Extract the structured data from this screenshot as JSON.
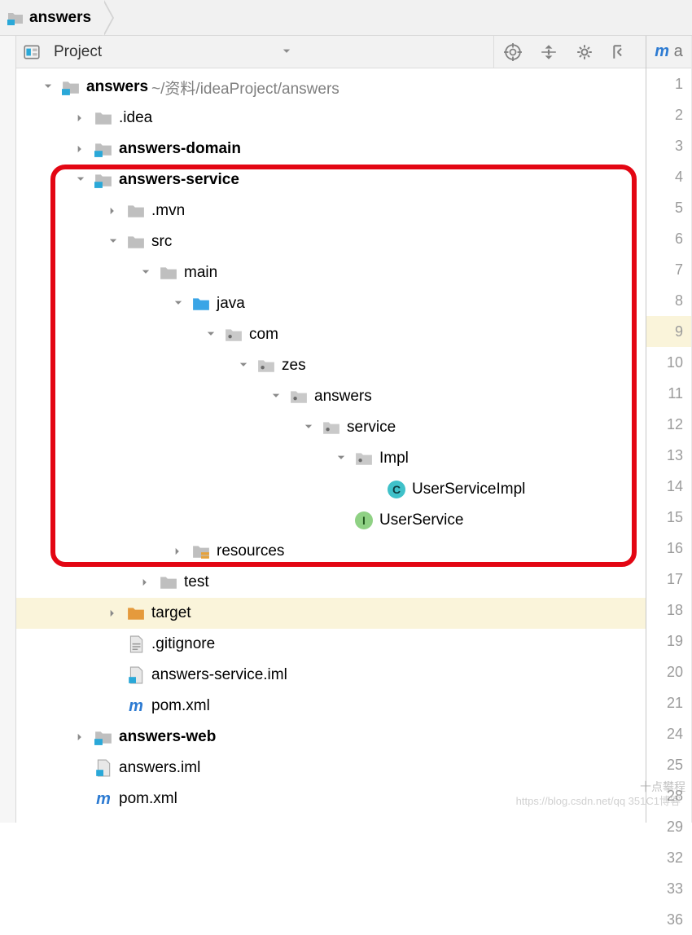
{
  "breadcrumb": {
    "root": "answers"
  },
  "panel": {
    "title": "Project",
    "gutterTopGlyph": "m",
    "gutterTopTrail": "a"
  },
  "tree": {
    "root": {
      "name": "answers",
      "path": "~/资料/ideaProject/answers"
    },
    "rows": [
      {
        "label": ".idea"
      },
      {
        "label": "answers-domain"
      },
      {
        "label": "answers-service"
      },
      {
        "label": ".mvn"
      },
      {
        "label": "src"
      },
      {
        "label": "main"
      },
      {
        "label": "java"
      },
      {
        "label": "com"
      },
      {
        "label": "zes"
      },
      {
        "label": "answers"
      },
      {
        "label": "service"
      },
      {
        "label": "Impl"
      },
      {
        "label": "UserServiceImpl"
      },
      {
        "label": "UserService"
      },
      {
        "label": "resources"
      },
      {
        "label": "test"
      },
      {
        "label": "target"
      },
      {
        "label": ".gitignore"
      },
      {
        "label": "answers-service.iml"
      },
      {
        "label": "pom.xml"
      },
      {
        "label": "answers-web"
      },
      {
        "label": "answers.iml"
      },
      {
        "label": "pom.xml"
      }
    ]
  },
  "gutter": {
    "lines": [
      1,
      2,
      3,
      4,
      5,
      6,
      7,
      8,
      9,
      10,
      11,
      12,
      13,
      14,
      15,
      16,
      17,
      18,
      19,
      20,
      21,
      24,
      25,
      28,
      29,
      32,
      33,
      36
    ],
    "highlight": 9
  },
  "watermark": {
    "a": "十点攀程",
    "b": "https://blog.csdn.net/qq 351C1博客"
  }
}
